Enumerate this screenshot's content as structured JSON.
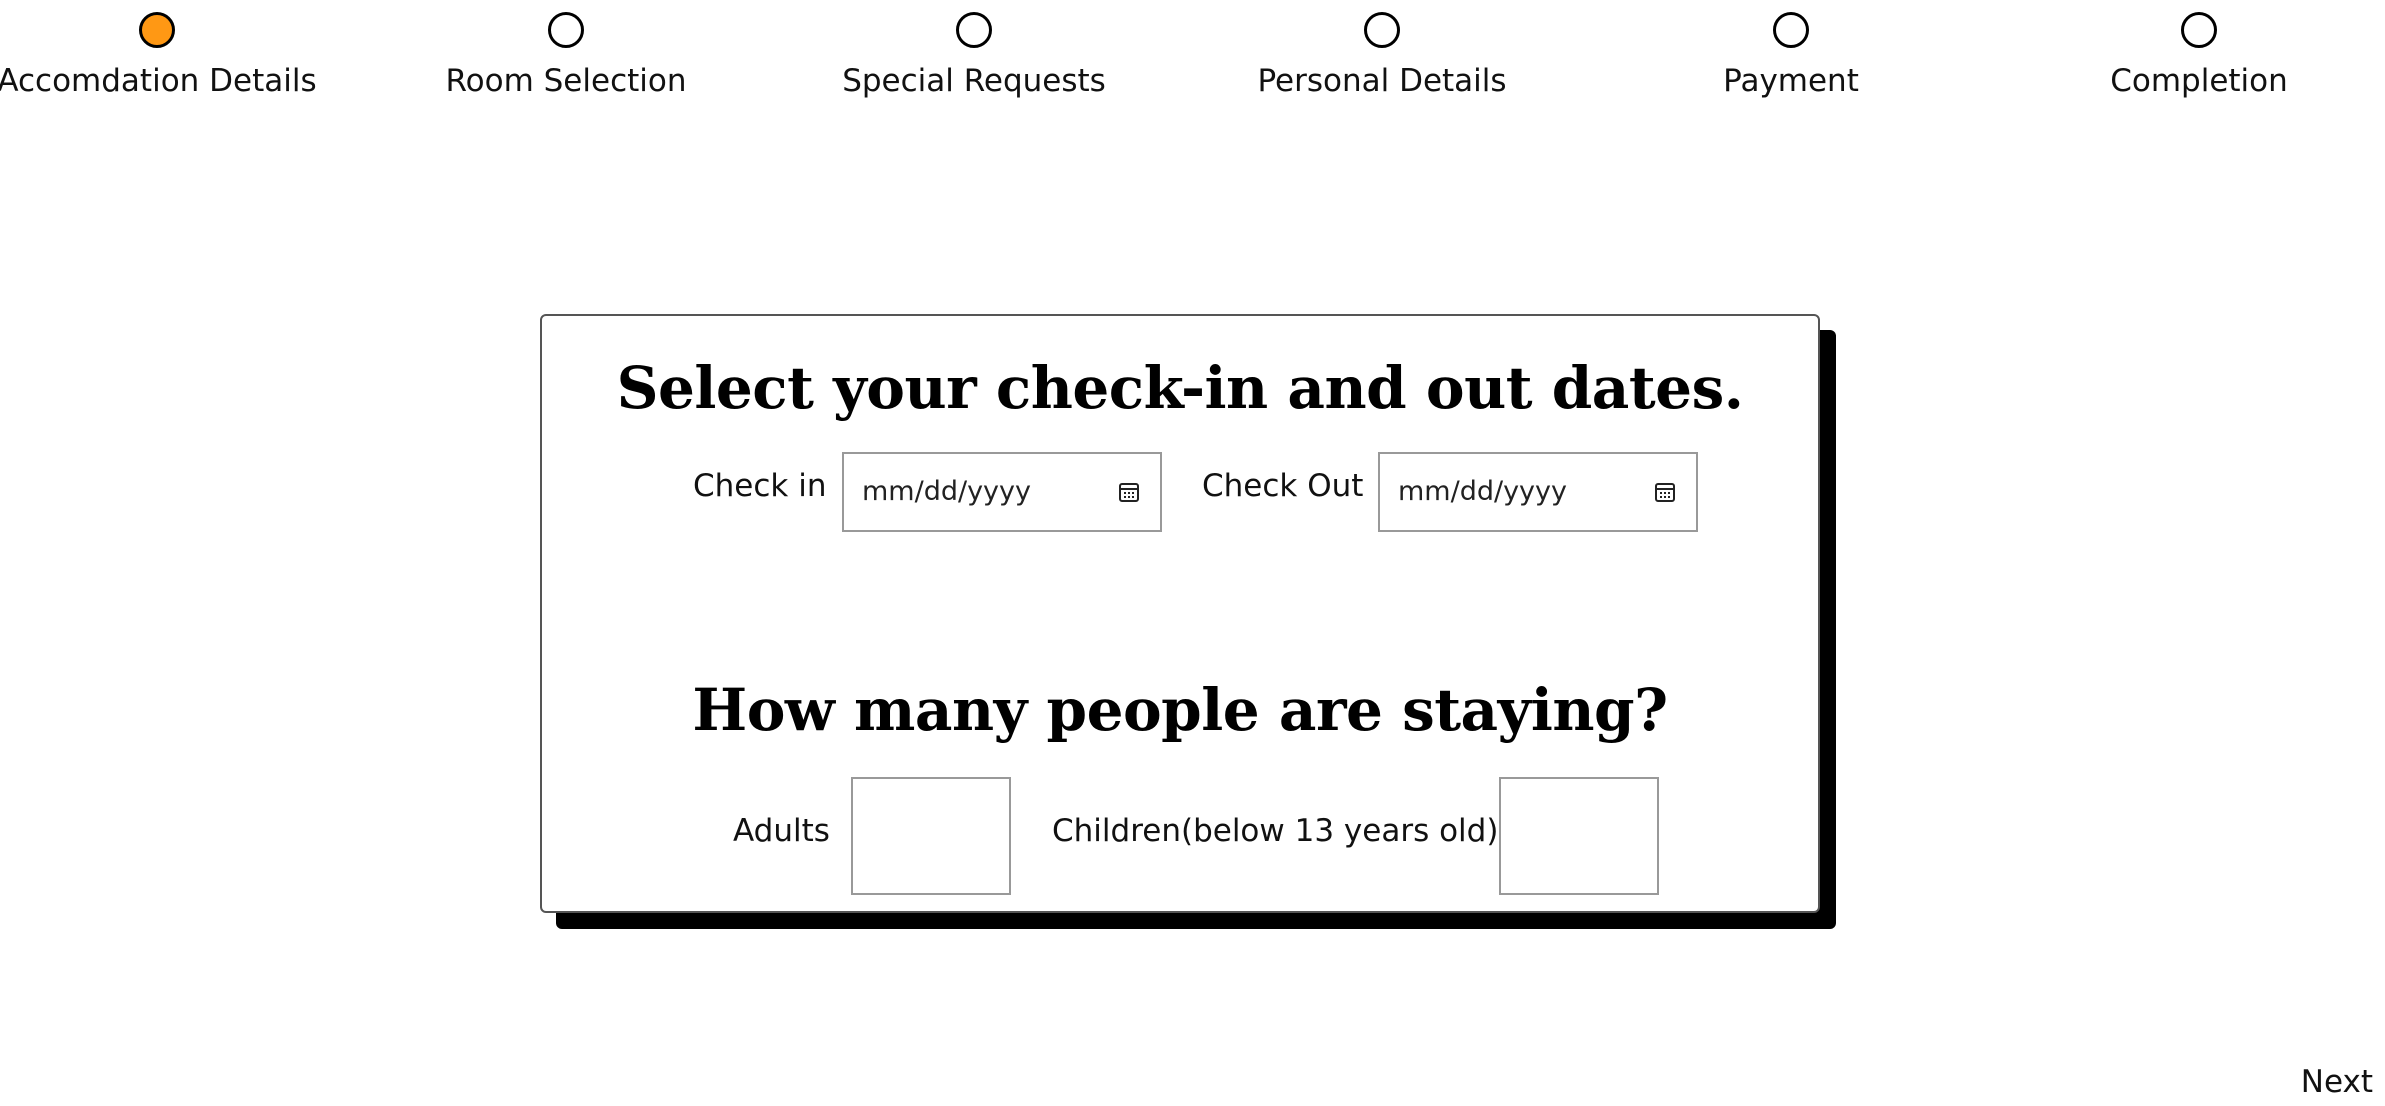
{
  "stepper": {
    "steps": [
      {
        "label": "Accomdation Details",
        "active": true
      },
      {
        "label": "Room Selection",
        "active": false
      },
      {
        "label": "Special Requests",
        "active": false
      },
      {
        "label": "Personal Details",
        "active": false
      },
      {
        "label": "Payment",
        "active": false
      },
      {
        "label": "Completion",
        "active": false
      }
    ],
    "active_color": "#ff9814"
  },
  "card": {
    "dates_heading": "Select your check-in and out dates.",
    "check_in_label": "Check in",
    "check_in_placeholder": "mm/dd/yyyy",
    "check_out_label": "Check Out",
    "check_out_placeholder": "mm/dd/yyyy",
    "people_heading": "How many people are staying?",
    "adults_label": "Adults",
    "adults_value": "",
    "children_label": "Children(below 13 years old)",
    "children_value": ""
  },
  "footer": {
    "next_label": "Next"
  }
}
